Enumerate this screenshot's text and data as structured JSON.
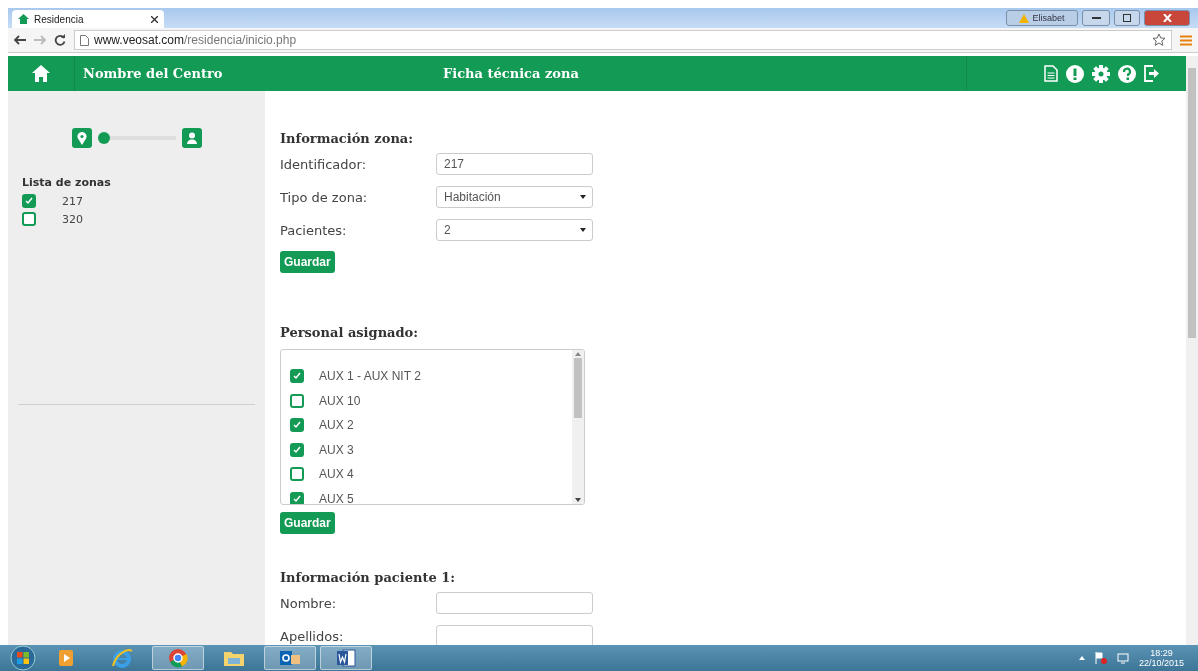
{
  "browser": {
    "tab_title": "Residencia",
    "url_host": "www.veosat.com",
    "url_path": "/residencia/inicio.php",
    "user": "Elisabet"
  },
  "header": {
    "center_name": "Nombre del Centro",
    "page_title": "Ficha técnica zona"
  },
  "sidebar": {
    "slider": {
      "level": 0
    },
    "zones_title": "Lista de zonas",
    "zones": [
      {
        "label": "217",
        "checked": true
      },
      {
        "label": "320",
        "checked": false
      }
    ]
  },
  "zone_info": {
    "title": "Información zona:",
    "fields": [
      {
        "kind": "text",
        "label": "Identificador:",
        "value": "217"
      },
      {
        "kind": "select",
        "label": "Tipo de zona:",
        "value": "Habitación"
      },
      {
        "kind": "select",
        "label": "Pacientes:",
        "value": "2"
      }
    ],
    "button": "Guardar"
  },
  "staff": {
    "title": "Personal asignado:",
    "items": [
      {
        "label": "AUX 1 - AUX NIT 2",
        "checked": true
      },
      {
        "label": "AUX 10",
        "checked": false
      },
      {
        "label": "AUX 2",
        "checked": true
      },
      {
        "label": "AUX 3",
        "checked": true
      },
      {
        "label": "AUX 4",
        "checked": false
      },
      {
        "label": "AUX 5",
        "checked": true
      }
    ],
    "button": "Guardar"
  },
  "patient": {
    "title": "Información paciente 1:",
    "fields": [
      {
        "kind": "text",
        "label": "Nombre:"
      },
      {
        "kind": "text",
        "label": "Apellidos:"
      }
    ]
  },
  "taskbar": {
    "apps": [
      {
        "kind": "media",
        "selected": false
      },
      {
        "kind": "ie",
        "selected": false
      },
      {
        "kind": "chrome",
        "selected": true
      },
      {
        "kind": "folder",
        "selected": false
      },
      {
        "kind": "outlook",
        "selected": true
      },
      {
        "kind": "word",
        "selected": true
      }
    ],
    "time": "18:29",
    "date": "22/10/2015"
  }
}
